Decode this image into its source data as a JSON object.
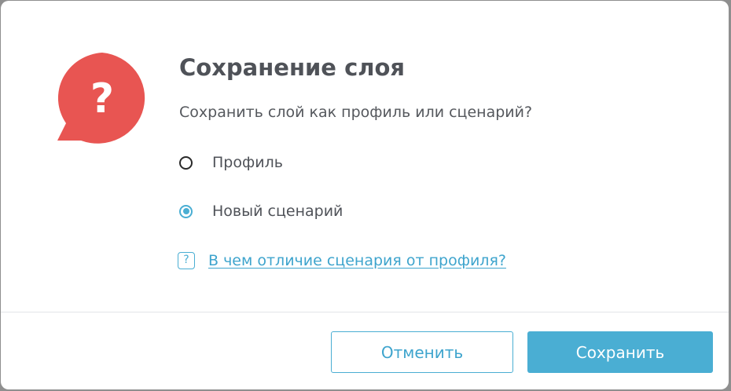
{
  "dialog": {
    "title": "Сохранение слоя",
    "question": "Сохранить слой как профиль или сценарий?",
    "icon": "question-bubble-icon",
    "options": [
      {
        "label": "Профиль",
        "selected": false
      },
      {
        "label": "Новый сценарий",
        "selected": true
      }
    ],
    "help_icon_glyph": "?",
    "help_link": "В чем отличие сценария от профиля?",
    "buttons": {
      "cancel_label": "Отменить",
      "save_label": "Сохранить"
    }
  },
  "colors": {
    "accent": "#4aaed3",
    "alert_icon": "#e85552",
    "text": "#4f5258"
  }
}
